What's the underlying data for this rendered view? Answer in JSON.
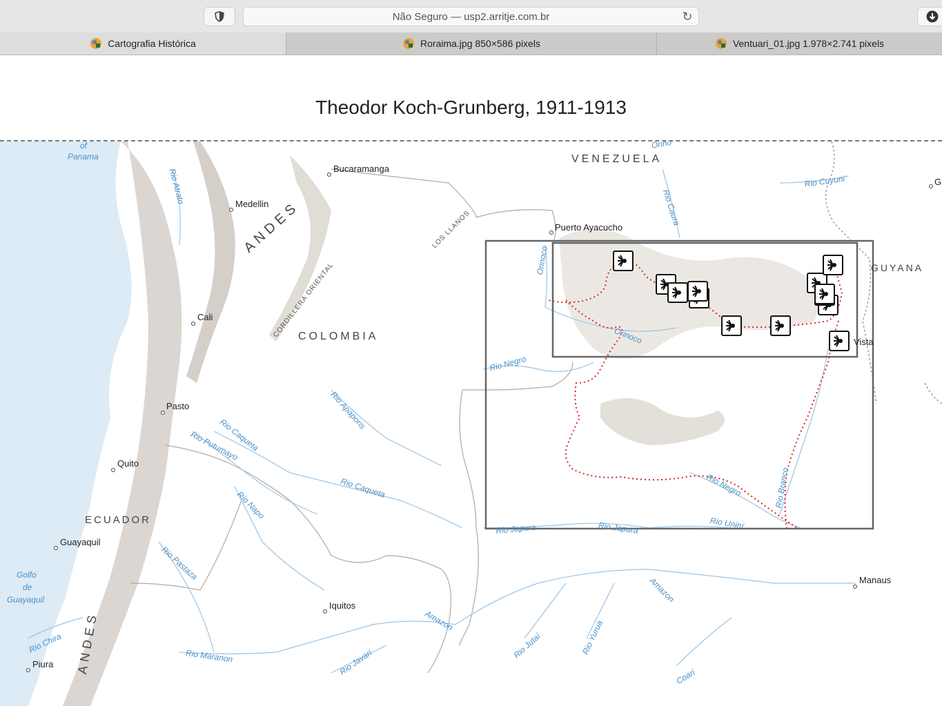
{
  "browser": {
    "url_text": "Não Seguro — usp2.arritje.com.br",
    "tabs": [
      {
        "label": "Cartografia Histórica"
      },
      {
        "label": "Roraima.jpg 850×586 pixels"
      },
      {
        "label": "Ventuari_01.jpg 1.978×2.741 pixels"
      }
    ]
  },
  "page": {
    "title": "Theodor Koch-Grunberg, 1911-1913"
  },
  "map": {
    "countries": [
      "VENEZUELA",
      "COLOMBIA",
      "ECUADOR",
      "GUYANA"
    ],
    "mountains": [
      "ANDES",
      "ANDES"
    ],
    "regions": [
      "LOS LLANOS",
      "CORDILLERA ORIENTAL"
    ],
    "cities": [
      "Bucaramanga",
      "Medellin",
      "Puerto Ayacucho",
      "Cali",
      "Pasto",
      "Quito",
      "Guayaquil",
      "Iquitos",
      "Piura",
      "Manaus",
      "Vista",
      "G"
    ],
    "rivers": [
      "Rio Atrato",
      "Rio Caura",
      "Rio Cuyuni",
      "Orinoco",
      "Orinoco",
      "Rio Negro",
      "Rio Apaporis",
      "Rio Caqueta",
      "Rio Putumayo",
      "Rio Caqueta",
      "Rio Napo",
      "Rio Pastaza",
      "Rio Chira",
      "Rio Maranon",
      "Rio Javari",
      "Amazon",
      "Rio Japura",
      "Rio Japura",
      "Rio Negro",
      "Rio Branco",
      "Rio Uniní",
      "Amazon",
      "Rio Jutaí",
      "Rio Yurua",
      "Coari",
      "Orino"
    ],
    "oceans": [
      "Panama",
      "Golfo",
      "de",
      "Guayaquil",
      "of"
    ],
    "marker_icon": "camera-marker-icon",
    "colors": {
      "route": "#e02020",
      "rivers": "#4a90c8",
      "water": "#dcebf5",
      "box": "#666666"
    }
  }
}
